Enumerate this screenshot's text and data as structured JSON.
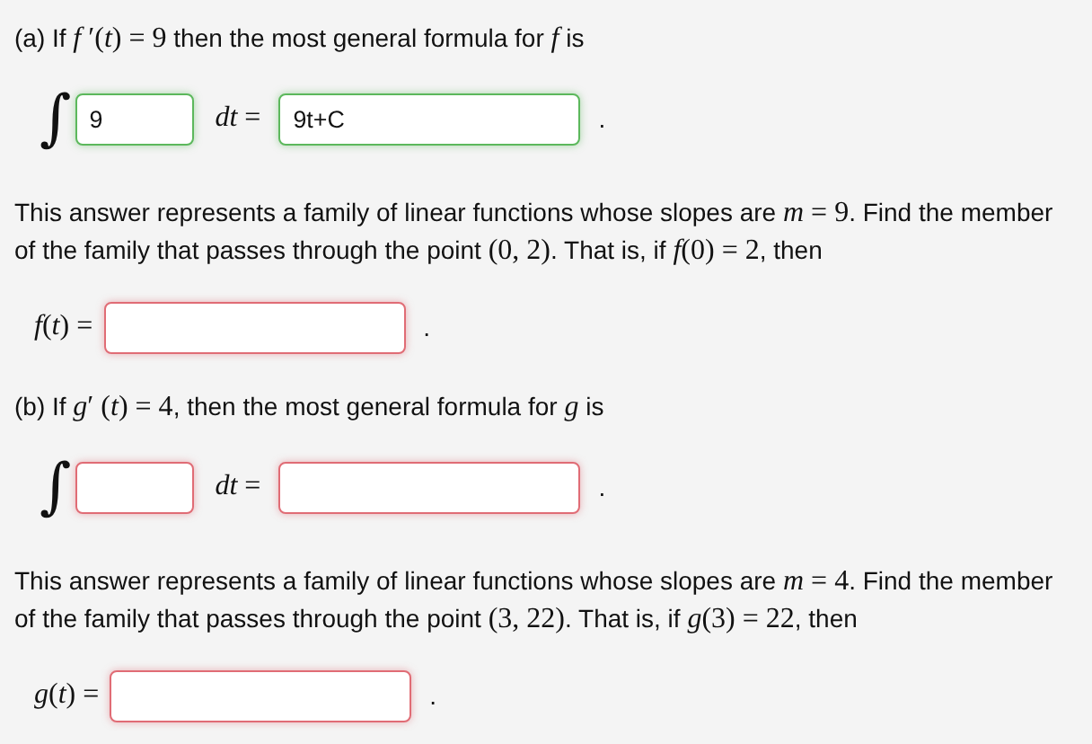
{
  "parts": [
    {
      "question": [
        {
          "kind": "text",
          "s": "(a) If "
        },
        {
          "kind": "math",
          "s": "*f* ′(*t*) = 9"
        },
        {
          "kind": "text",
          "s": " then the most general formula for "
        },
        {
          "kind": "math",
          "s": "*f*"
        },
        {
          "kind": "text",
          "s": " is"
        }
      ],
      "integral": {
        "sign": "∫",
        "integrand": {
          "value": "9",
          "correct": true
        },
        "differential": "*dt* =",
        "result": {
          "value": "9t+C",
          "correct": true
        },
        "end": "."
      },
      "explanation": [
        {
          "kind": "text",
          "s": "This answer represents a family of linear functions whose slopes are "
        },
        {
          "kind": "math",
          "s": "*m* = 9"
        },
        {
          "kind": "text",
          "s": ". Find the member of the family that passes through the point "
        },
        {
          "kind": "math",
          "s": "(0, 2)"
        },
        {
          "kind": "text",
          "s": ". That is, if "
        },
        {
          "kind": "math",
          "s": "*f*(0) = 2"
        },
        {
          "kind": "text",
          "s": ", then"
        }
      ],
      "answer": {
        "label": "*f*(*t*) =",
        "field": {
          "correct": false
        },
        "end": "."
      }
    },
    {
      "question": [
        {
          "kind": "text",
          "s": "(b) If "
        },
        {
          "kind": "math",
          "s": "*g*′ (*t*) = 4"
        },
        {
          "kind": "text",
          "s": ", then the most general formula for "
        },
        {
          "kind": "math",
          "s": "*g*"
        },
        {
          "kind": "text",
          "s": " is"
        }
      ],
      "integral": {
        "sign": "∫",
        "integrand": {
          "correct": false
        },
        "differential": "*dt* =",
        "result": {
          "correct": false
        },
        "end": "."
      },
      "explanation": [
        {
          "kind": "text",
          "s": "This answer represents a family of linear functions whose slopes are "
        },
        {
          "kind": "math",
          "s": "*m* = 4"
        },
        {
          "kind": "text",
          "s": ". Find the member of the family that passes through the point "
        },
        {
          "kind": "math",
          "s": "(3, 22)"
        },
        {
          "kind": "text",
          "s": ". That is, if "
        },
        {
          "kind": "math",
          "s": "*g*(3) = 22"
        },
        {
          "kind": "text",
          "s": ", then"
        }
      ],
      "answer": {
        "label": "*g*(*t*) =",
        "field": {
          "correct": false
        },
        "end": "."
      }
    }
  ]
}
